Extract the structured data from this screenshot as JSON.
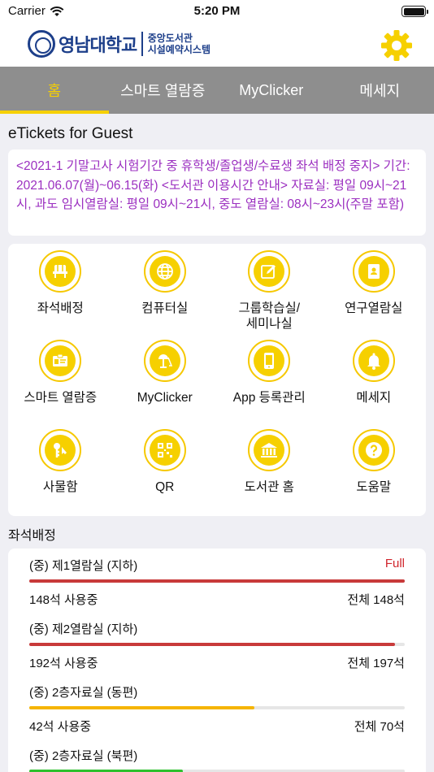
{
  "status": {
    "carrier": "Carrier",
    "time": "5:20 PM"
  },
  "header": {
    "logo_name": "영남대학교",
    "logo_sub_1": "중앙도서관",
    "logo_sub_2": "시설예약시스템",
    "accent": "#f6d000"
  },
  "tabs": [
    {
      "label": "홈",
      "active": true
    },
    {
      "label": "스마트 열람증",
      "active": false
    },
    {
      "label": "MyClicker",
      "active": false
    },
    {
      "label": "메세지",
      "active": false
    }
  ],
  "etickets": {
    "title": "eTickets for Guest",
    "notice": "<2021-1 기말고사 시험기간 중 휴학생/졸업생/수료생 좌석 배정 중지> 기간: 2021.06.07(월)~06.15(화) <도서관 이용시간 안내> 자료실: 평일 09시~21시, 과도 임시열람실: 평일 09시~21시, 중도 열람실: 08시~23시(주말 포함)",
    "notice_color": "#9b2fc0"
  },
  "menu": [
    {
      "label": "좌석배정",
      "icon": "seat-icon"
    },
    {
      "label": "컴퓨터실",
      "icon": "globe-icon"
    },
    {
      "label": "그룹학습실/\n세미나실",
      "icon": "edit-icon"
    },
    {
      "label": "연구열람실",
      "icon": "contact-book-icon"
    },
    {
      "label": "스마트 열람증",
      "icon": "id-card-icon"
    },
    {
      "label": "MyClicker",
      "icon": "desk-lamp-icon"
    },
    {
      "label": "App 등록관리",
      "icon": "smartphone-icon"
    },
    {
      "label": "메세지",
      "icon": "bell-icon"
    },
    {
      "label": "사물함",
      "icon": "key-icon"
    },
    {
      "label": "QR",
      "icon": "qr-code-icon"
    },
    {
      "label": "도서관 홈",
      "icon": "library-building-icon"
    },
    {
      "label": "도움말",
      "icon": "help-icon"
    }
  ],
  "seats": {
    "title": "좌석배정",
    "rooms": [
      {
        "name": "(중) 제1열람실 (지하)",
        "status": "Full",
        "used": "148석 사용중",
        "total": "전체 148석",
        "ratio": 1.0,
        "color": "#c83a3a"
      },
      {
        "name": "(중) 제2열람실 (지하)",
        "status": "",
        "used": "192석 사용중",
        "total": "전체 197석",
        "ratio": 0.975,
        "color": "#c83a3a"
      },
      {
        "name": "(중) 2층자료실 (동편)",
        "status": "",
        "used": "42석 사용중",
        "total": "전체 70석",
        "ratio": 0.6,
        "color": "#f5b400"
      },
      {
        "name": "(중) 2층자료실 (북편)",
        "status": "",
        "used": "",
        "total": "",
        "ratio": 0.41,
        "color": "#2ec12e"
      }
    ]
  }
}
